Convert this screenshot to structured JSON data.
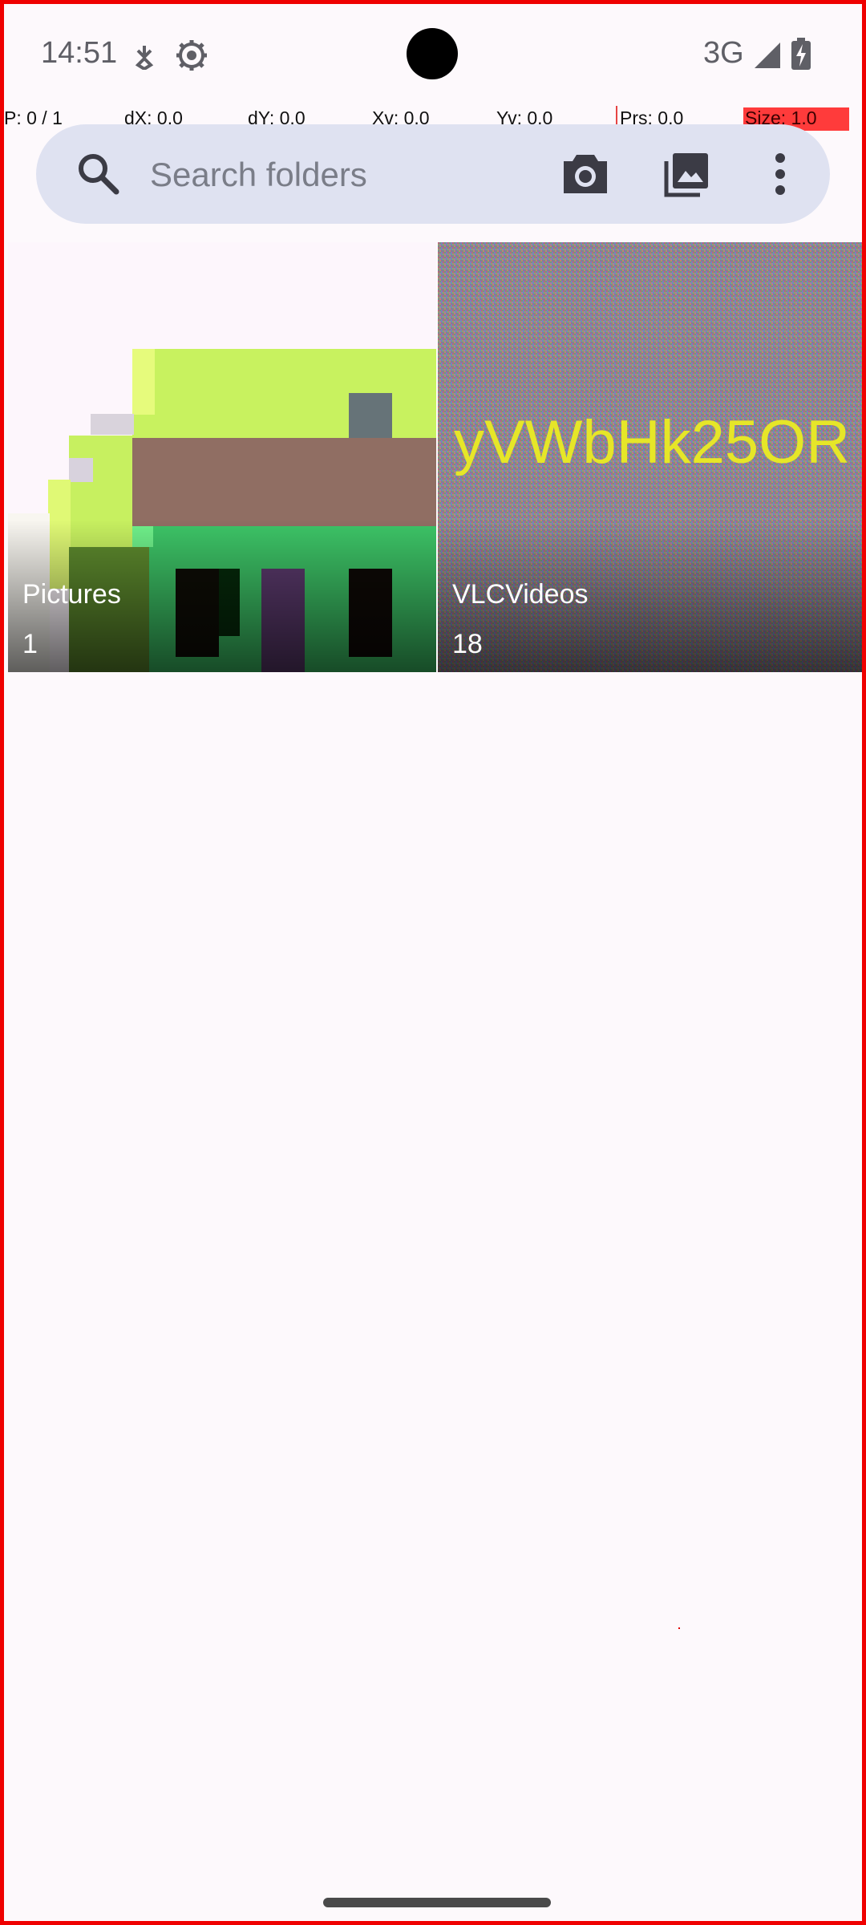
{
  "status_bar": {
    "time": "14:51",
    "network": "3G",
    "icons": [
      "notification-icon",
      "settings-icon",
      "signal-icon",
      "battery-charging-icon"
    ]
  },
  "pointer_overlay": {
    "p": "P: 0 / 1",
    "dx": "dX: 0.0",
    "dy": "dY: 0.0",
    "xv": "Xv: 0.0",
    "yv": "Yv: 0.0",
    "prs": "Prs: 0.0",
    "size": "Size: 1.0"
  },
  "search": {
    "placeholder": "Search folders",
    "value": "",
    "actions": [
      "camera-icon",
      "gallery-icon",
      "more-options-icon"
    ]
  },
  "folders": [
    {
      "name": "Pictures",
      "count": "1"
    },
    {
      "name": "VLCVideos",
      "count": "18",
      "thumbnail_text": "yVWbHk25OR"
    }
  ],
  "colors": {
    "background": "#fdf9fc",
    "search_bar": "#dfe2f1",
    "frame_border": "#ef0000"
  }
}
